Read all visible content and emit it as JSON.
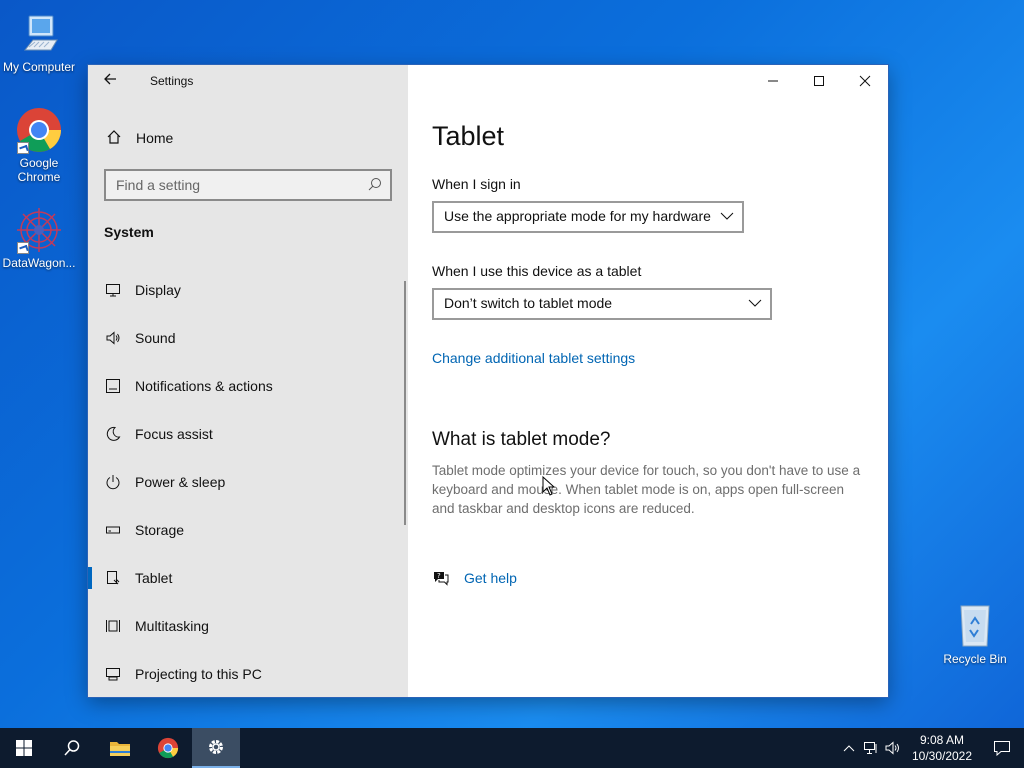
{
  "desktop": {
    "icons": [
      {
        "label": "My Computer",
        "icon": "computer-icon"
      },
      {
        "label": "Google Chrome",
        "icon": "chrome-icon"
      },
      {
        "label": "DataWagon...",
        "icon": "datawagon-icon"
      },
      {
        "label": "Recycle Bin",
        "icon": "recycle-bin-icon"
      }
    ]
  },
  "window": {
    "title": "Settings",
    "home_label": "Home",
    "search_placeholder": "Find a setting",
    "section_title": "System",
    "nav_items": [
      {
        "label": "Display",
        "icon": "display-icon"
      },
      {
        "label": "Sound",
        "icon": "sound-icon"
      },
      {
        "label": "Notifications & actions",
        "icon": "notifications-icon"
      },
      {
        "label": "Focus assist",
        "icon": "moon-icon"
      },
      {
        "label": "Power & sleep",
        "icon": "power-icon"
      },
      {
        "label": "Storage",
        "icon": "storage-icon"
      },
      {
        "label": "Tablet",
        "icon": "tablet-icon",
        "active": true
      },
      {
        "label": "Multitasking",
        "icon": "multitasking-icon"
      },
      {
        "label": "Projecting to this PC",
        "icon": "projecting-icon"
      }
    ]
  },
  "content": {
    "page_title": "Tablet",
    "sign_in_label": "When I sign in",
    "sign_in_value": "Use the appropriate mode for my hardware",
    "tablet_use_label": "When I use this device as a tablet",
    "tablet_use_value": "Don’t switch to tablet mode",
    "additional_link": "Change additional tablet settings",
    "what_is_title": "What is tablet mode?",
    "what_is_text": "Tablet mode optimizes your device for touch, so you don't have to use a keyboard and mouse. When tablet mode is on, apps open full-screen and taskbar and desktop icons are reduced.",
    "help_link": "Get help"
  },
  "taskbar": {
    "time": "9:08 AM",
    "date": "10/30/2022"
  },
  "colors": {
    "accent": "#0067c0",
    "link": "#0065b3",
    "sidebar_bg": "#e6e6e6",
    "taskbar_bg": "#0d1b2e"
  }
}
